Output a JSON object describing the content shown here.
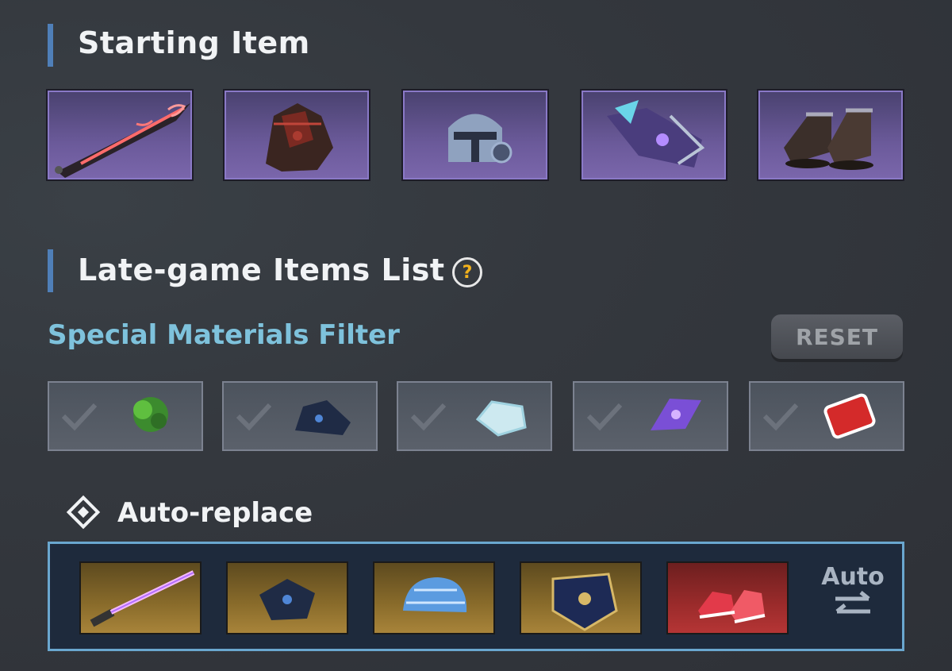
{
  "starting": {
    "title": "Starting Item",
    "items": [
      {
        "name": "weapon-blade-icon"
      },
      {
        "name": "jacket-armor-icon"
      },
      {
        "name": "helmet-icon"
      },
      {
        "name": "arm-gauntlet-icon"
      },
      {
        "name": "boots-icon"
      }
    ]
  },
  "lategame": {
    "title": "Late-game Items List",
    "help": "?",
    "filter_title": "Special Materials Filter",
    "reset_label": "RESET",
    "materials": [
      {
        "name": "tree-of-life-icon"
      },
      {
        "name": "meteorite-icon"
      },
      {
        "name": "mithril-icon"
      },
      {
        "name": "force-core-icon"
      },
      {
        "name": "vf-blood-sample-icon"
      }
    ]
  },
  "auto_replace": {
    "label": "Auto-replace",
    "button_label": "Auto",
    "items": [
      {
        "name": "lightsaber-icon",
        "rarity": "gold"
      },
      {
        "name": "chest-armor-icon",
        "rarity": "gold"
      },
      {
        "name": "checked-hat-icon",
        "rarity": "gold"
      },
      {
        "name": "shield-bracer-icon",
        "rarity": "gold"
      },
      {
        "name": "red-shoes-icon",
        "rarity": "red"
      }
    ]
  },
  "colors": {
    "accent": "#4f7fb8",
    "filter_text": "#7ec2dc",
    "start_slot": "#6b5a9a",
    "gold_slot": "#8a6c2b",
    "red_slot": "#9b2b2b",
    "auto_border": "#6aa7cf"
  }
}
